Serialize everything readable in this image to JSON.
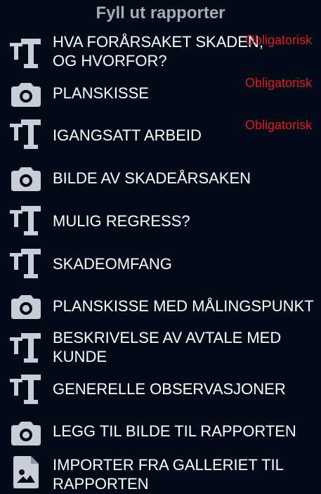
{
  "header": {
    "title": "Fyll ut rapporter"
  },
  "items": [
    {
      "label": "HVA FORÅRSAKET SKADEN, OG HVORFOR?",
      "icon": "text-icon",
      "required": "Obligatorisk"
    },
    {
      "label": "PLANSKISSE",
      "icon": "camera-icon",
      "required": "Obligatorisk"
    },
    {
      "label": "IGANGSATT ARBEID",
      "icon": "text-icon",
      "required": "Obligatorisk"
    },
    {
      "label": "BILDE AV SKADEÅRSAKEN",
      "icon": "camera-icon"
    },
    {
      "label": "MULIG REGRESS?",
      "icon": "text-icon"
    },
    {
      "label": "SKADEOMFANG",
      "icon": "text-icon"
    },
    {
      "label": "PLANSKISSE MED MÅLINGSPUNKT",
      "icon": "camera-icon"
    },
    {
      "label": "BESKRIVELSE AV AVTALE MED KUNDE",
      "icon": "text-icon"
    },
    {
      "label": "GENERELLE OBSERVASJONER",
      "icon": "text-icon"
    },
    {
      "label": "LEGG TIL BILDE TIL RAPPORTEN",
      "icon": "camera-icon"
    },
    {
      "label": "IMPORTER FRA GALLERIET TIL RAPPORTEN",
      "icon": "image-file-icon"
    }
  ],
  "colors": {
    "background": "#040b18",
    "icon": "#c8cdd6",
    "required": "#e11d1d",
    "title": "#a9abb3"
  }
}
